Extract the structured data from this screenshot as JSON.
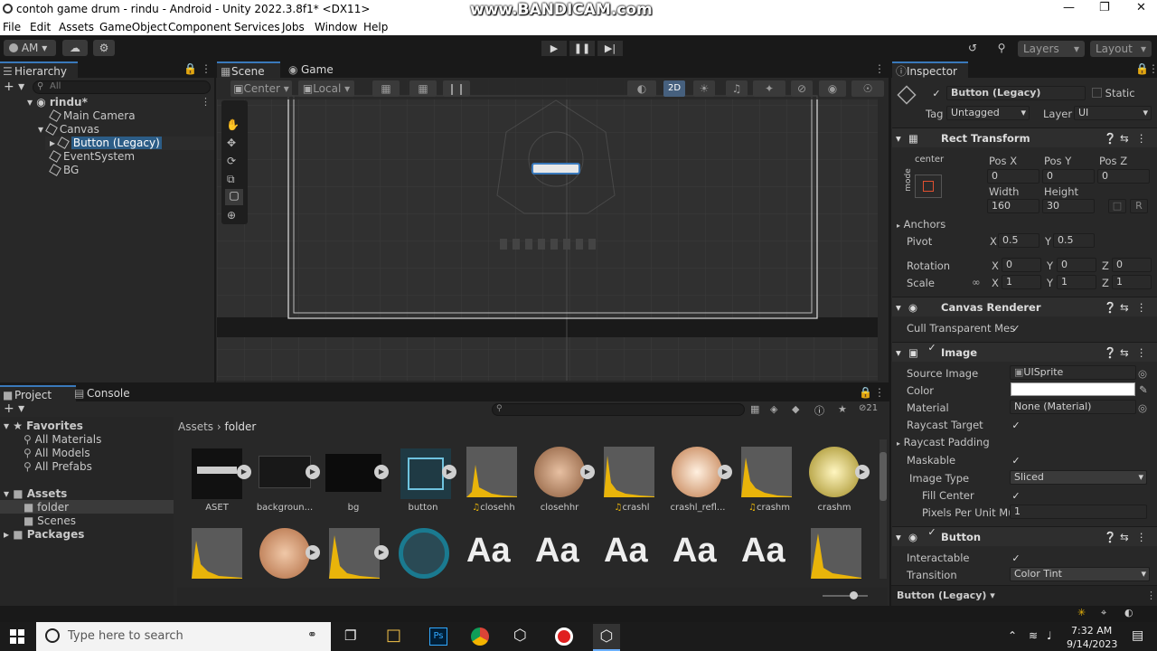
{
  "window": {
    "title": "contoh game drum - rindu - Android - Unity 2022.3.8f1* <DX11>",
    "watermark": "www.BANDICAM.com"
  },
  "menu": [
    "File",
    "Edit",
    "Assets",
    "GameObject",
    "Component",
    "Services",
    "Jobs",
    "Window",
    "Help"
  ],
  "toolbar": {
    "account": "AM",
    "layers": "Layers",
    "layout": "Layout"
  },
  "hierarchy": {
    "tab": "Hierarchy",
    "search_placeholder": "All",
    "items": [
      {
        "label": "rindu*"
      },
      {
        "label": "Main Camera"
      },
      {
        "label": "Canvas"
      },
      {
        "label": "Button (Legacy)"
      },
      {
        "label": "EventSystem"
      },
      {
        "label": "BG"
      }
    ]
  },
  "scene": {
    "tabs": [
      "Scene",
      "Game"
    ],
    "pivot": "Center",
    "space": "Local",
    "mode2d": "2D"
  },
  "inspector": {
    "tab": "Inspector",
    "object_name": "Button (Legacy)",
    "static": "Static",
    "tag_label": "Tag",
    "tag": "Untagged",
    "layer_label": "Layer",
    "layer": "UI",
    "rect": {
      "title": "Rect Transform",
      "anchor_mode": "center",
      "mode_label": "mode",
      "posx_label": "Pos X",
      "posy_label": "Pos Y",
      "posz_label": "Pos Z",
      "posx": "0",
      "posy": "0",
      "posz": "0",
      "width_label": "Width",
      "height_label": "Height",
      "width": "160",
      "height": "30",
      "raw": "R",
      "anchors": "Anchors",
      "pivot": "Pivot",
      "pivot_x": "0.5",
      "pivot_y": "0.5",
      "rotation": "Rotation",
      "rot_x": "0",
      "rot_y": "0",
      "rot_z": "0",
      "scale": "Scale",
      "scale_x": "1",
      "scale_y": "1",
      "scale_z": "1",
      "x": "X",
      "y": "Y",
      "z": "Z"
    },
    "canvas_renderer": {
      "title": "Canvas Renderer",
      "cull": "Cull Transparent Mes"
    },
    "image": {
      "title": "Image",
      "source_image_label": "Source Image",
      "source_image": "UISprite",
      "color_label": "Color",
      "material_label": "Material",
      "material": "None (Material)",
      "raycast_target": "Raycast Target",
      "raycast_padding": "Raycast Padding",
      "maskable": "Maskable",
      "image_type_label": "Image Type",
      "image_type": "Sliced",
      "fill_center": "Fill Center",
      "ppu_label": "Pixels Per Unit Mul",
      "ppu": "1"
    },
    "button": {
      "title": "Button",
      "interactable": "Interactable",
      "transition_label": "Transition",
      "transition": "Color Tint"
    },
    "footer": "Button (Legacy)"
  },
  "project": {
    "tabs": [
      "Project",
      "Console"
    ],
    "breadcrumb": [
      "Assets",
      "folder"
    ],
    "count": "21",
    "favorites": {
      "label": "Favorites",
      "items": [
        "All Materials",
        "All Models",
        "All Prefabs"
      ]
    },
    "assets_tree": {
      "label": "Assets",
      "items": [
        "folder",
        "Scenes"
      ],
      "packages": "Packages"
    },
    "row1": [
      "ASET",
      "backgroun...",
      "bg",
      "button",
      "closehh",
      "closehhr",
      "crashl",
      "crashl_refl...",
      "crashm",
      "crashm"
    ],
    "font_glyph": "Aa"
  },
  "taskbar": {
    "search_placeholder": "Type here to search",
    "time": "7:32 AM",
    "date": "9/14/2023"
  },
  "colors": {
    "accent": "#3a79bb",
    "selection": "#2c5d87",
    "audio": "#e9b40a"
  }
}
